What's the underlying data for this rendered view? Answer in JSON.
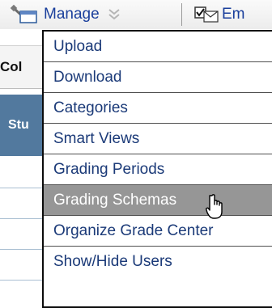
{
  "toolbar": {
    "manage_label": "Manage",
    "email_label": "Em"
  },
  "background": {
    "column_header_partial": "Col",
    "student_header_partial": "Stu"
  },
  "menu": {
    "items": [
      {
        "label": "Upload"
      },
      {
        "label": "Download"
      },
      {
        "label": "Categories"
      },
      {
        "label": "Smart Views"
      },
      {
        "label": "Grading Periods"
      },
      {
        "label": "Grading Schemas"
      },
      {
        "label": "Organize Grade Center"
      },
      {
        "label": "Show/Hide Users"
      }
    ],
    "hovered_index": 5
  },
  "colors": {
    "menu_text": "#1b3a78",
    "hover_bg": "#969696",
    "header_blue": "#52799e"
  },
  "icons": [
    "wrench-icon",
    "double-chevron-down-icon",
    "email-icon",
    "hand-pointer-cursor-icon"
  ]
}
